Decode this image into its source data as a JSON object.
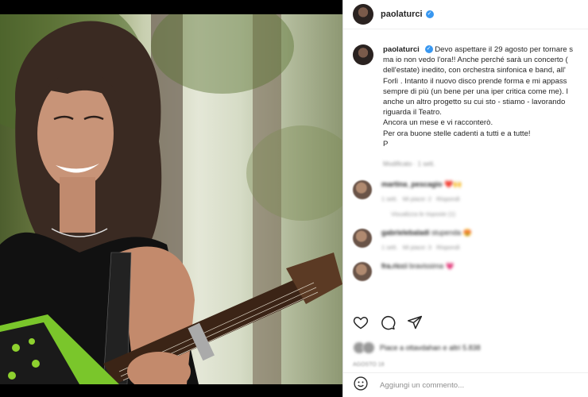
{
  "post": {
    "username": "paolaturci",
    "caption_lines": [
      "Devo aspettare il 29 agosto per tornare s",
      "ma io non vedo l'ora!! Anche perché sarà un concerto (",
      "dell'estate) inedito, con orchestra sinfonica e band, all'",
      "Forlì . Intanto il nuovo disco prende forma e mi appass",
      "sempre di più (un bene per una iper critica come me). I",
      "anche un altro progetto su cui sto - stiamo - lavorando",
      "riguarda il Teatro.",
      "Ancora un mese e vi racconterò.",
      "Per ora buone stelle cadenti a tutti e a tutte!",
      "P"
    ],
    "caption_meta": "Modificato · 1 sett.",
    "comments": [
      {
        "username": "martina_pescagio",
        "text": "❤️🙌",
        "meta": [
          "1 sett.",
          "Mi piace: 2",
          "Rispondi"
        ],
        "replies": "Visualizza le risposte (1)"
      },
      {
        "username": "gabrielebaladi",
        "text": "stupenda 😍",
        "meta": [
          "1 sett.",
          "Mi piace: 3",
          "Rispondi"
        ],
        "replies": ""
      },
      {
        "username": "fra.ricci",
        "text": "bravissima 💗",
        "meta": [],
        "replies": ""
      }
    ],
    "likes_text": "Piace a ottavdahan e altri 5.838",
    "date": "AGOSTO 18",
    "comment_placeholder": "Aggiungi un commento..."
  },
  "icons": [
    "heart-icon",
    "comment-icon",
    "share-icon",
    "emoji-icon",
    "verified-badge-icon"
  ],
  "colors": {
    "accent_blue": "#3897f0",
    "text": "#262626",
    "muted": "#8e8e8e",
    "border": "#dbdbdb"
  }
}
